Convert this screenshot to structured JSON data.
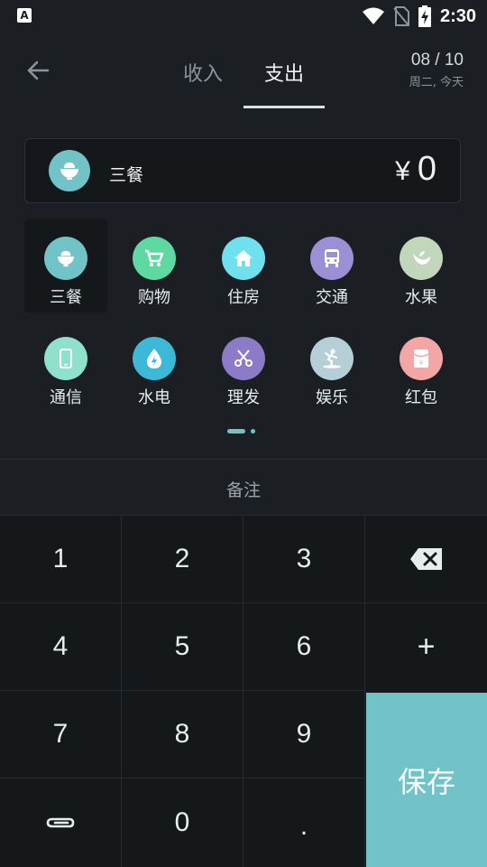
{
  "status_bar": {
    "app_icon_letter": "A",
    "time": "2:30",
    "icons": [
      "wifi-icon",
      "no-sim-icon",
      "battery-charging-icon"
    ]
  },
  "header": {
    "tabs": [
      {
        "label": "收入",
        "active": false
      },
      {
        "label": "支出",
        "active": true
      }
    ],
    "date": "08 / 10",
    "date_sub": "周二, 今天"
  },
  "amount": {
    "category": "三餐",
    "category_icon": "rice-bowl-icon",
    "currency": "¥",
    "value": "0"
  },
  "categories": [
    {
      "label": "三餐",
      "icon": "rice-bowl-icon",
      "color": "#72c3c8",
      "selected": true
    },
    {
      "label": "购物",
      "icon": "cart-icon",
      "color": "#5fd9a2",
      "selected": false
    },
    {
      "label": "住房",
      "icon": "house-icon",
      "color": "#6fe0ee",
      "selected": false
    },
    {
      "label": "交通",
      "icon": "bus-icon",
      "color": "#9b8fd6",
      "selected": false
    },
    {
      "label": "水果",
      "icon": "fruit-icon",
      "color": "#c2d6bc",
      "selected": false
    },
    {
      "label": "通信",
      "icon": "phone-icon",
      "color": "#8fe0cc",
      "selected": false
    },
    {
      "label": "水电",
      "icon": "water-drop-icon",
      "color": "#3cb9d6",
      "selected": false
    },
    {
      "label": "理发",
      "icon": "scissors-icon",
      "color": "#8c7cc8",
      "selected": false
    },
    {
      "label": "娱乐",
      "icon": "golf-icon",
      "color": "#b6cfd6",
      "selected": false
    },
    {
      "label": "红包",
      "icon": "red-envelope-icon",
      "color": "#f2a6a6",
      "selected": false
    }
  ],
  "pager": {
    "pages": 2,
    "current": 1
  },
  "note": {
    "label": "备注"
  },
  "keypad": {
    "keys": [
      "1",
      "2",
      "3",
      "4",
      "5",
      "6",
      "7",
      "8",
      "9",
      "0",
      "."
    ],
    "plus": "+",
    "save": "保存",
    "backspace_icon": "backspace-icon",
    "attach_icon": "paperclip-icon"
  },
  "colors": {
    "background": "#1b1f23",
    "accent": "#72c3c8"
  }
}
